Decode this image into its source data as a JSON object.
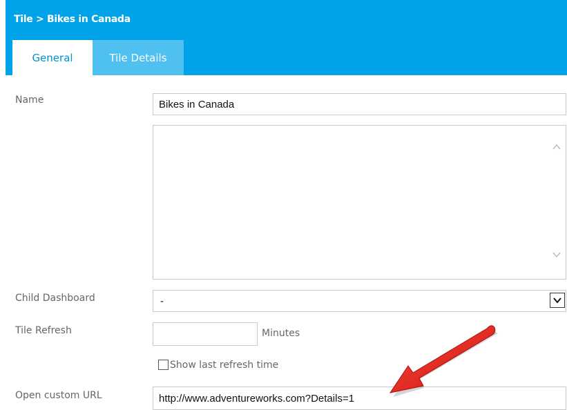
{
  "header": {
    "breadcrumb": "Tile > Bikes in Canada",
    "tabs": [
      {
        "label": "General",
        "active": true
      },
      {
        "label": "Tile Details",
        "active": false
      }
    ],
    "color": "#00a2e8"
  },
  "form": {
    "name_label": "Name",
    "name_value": "Bikes in Canada",
    "description_value": "",
    "child_dashboard_label": "Child Dashboard",
    "child_dashboard_value": "-",
    "tile_refresh_label": "Tile Refresh",
    "tile_refresh_value": "",
    "tile_refresh_unit": "Minutes",
    "show_last_refresh_label": "Show last refresh time",
    "show_last_refresh_checked": false,
    "custom_url_label": "Open custom URL",
    "custom_url_value": "http://www.adventureworks.com?Details=1"
  },
  "annotation": {
    "arrow_color": "#e8201d",
    "icon": "red-arrow-icon"
  }
}
